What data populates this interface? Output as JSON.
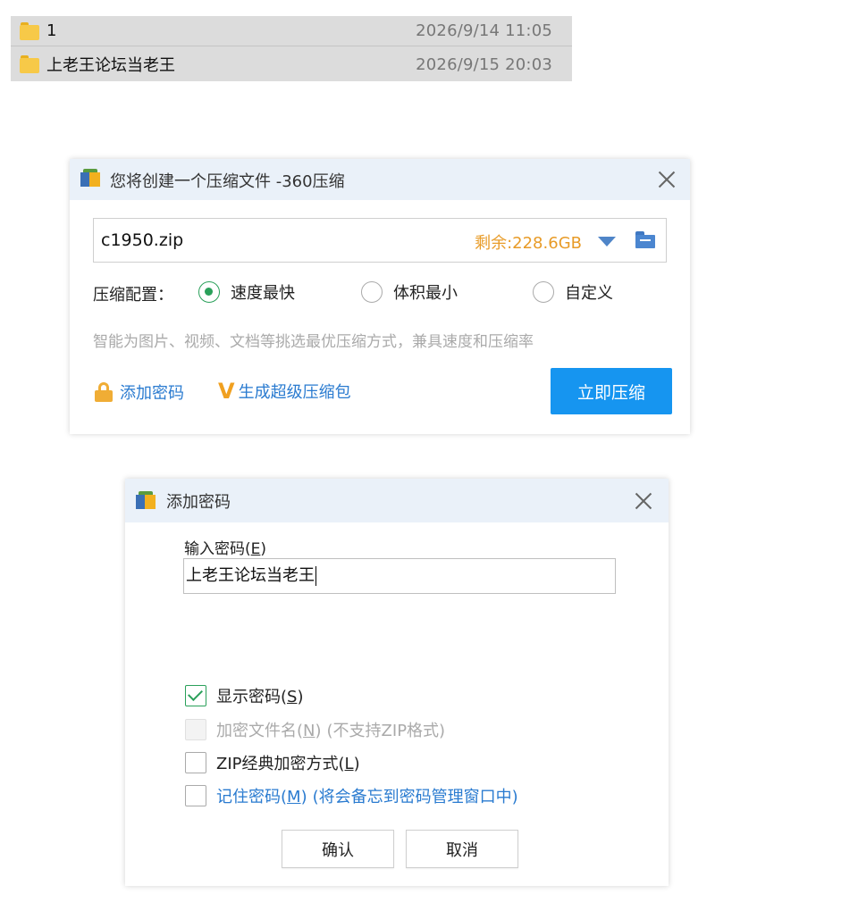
{
  "file_list": [
    {
      "name": "1",
      "date": "2026/9/14 11:05"
    },
    {
      "name": "上老王论坛当老王",
      "date": "2026/9/15 20:03"
    }
  ],
  "compress_dialog": {
    "title": "您将创建一个压缩文件 -360压缩",
    "path": "c1950.zip",
    "remaining": "剩余:228.6GB",
    "config_label": "压缩配置：",
    "options": [
      "速度最快",
      "体积最小",
      "自定义"
    ],
    "selected_option": "速度最快",
    "hint": "智能为图片、视频、文档等挑选最优压缩方式，兼具速度和压缩率",
    "add_password": "添加密码",
    "super_pack": "生成超级压缩包",
    "compress_now": "立即压缩",
    "accent_color": "#1695f0"
  },
  "password_dialog": {
    "title": "添加密码",
    "input_label": "输入密码(",
    "input_label_key": "E",
    "input_label_end": ")",
    "password_value": "上老王论坛当老王",
    "show_password": {
      "label": "显示密码(",
      "key": "S",
      "end": ")",
      "checked": true
    },
    "encrypt_names": {
      "label": "加密文件名(",
      "key": "N",
      "end": ")",
      "note": "(不支持ZIP格式)",
      "enabled": false
    },
    "zip_classic": {
      "label": "ZIP经典加密方式(",
      "key": "L",
      "end": ")",
      "checked": false
    },
    "remember": {
      "label": "记住密码(",
      "key": "M",
      "end": ")",
      "note": "(将会备忘到密码管理窗口中)",
      "checked": false
    },
    "ok_label": "确认",
    "cancel_label": "取消"
  },
  "icons": [
    "folder-icon",
    "app-icon",
    "close-icon",
    "dropdown-icon",
    "browse-folder-icon",
    "lock-icon",
    "v-icon",
    "check-icon"
  ]
}
